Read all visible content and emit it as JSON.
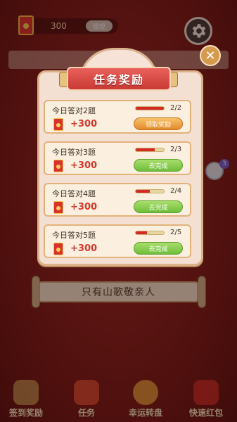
{
  "header": {
    "coin_value": "300",
    "withdraw_label": "提现"
  },
  "background": {
    "lyric_text": "只有山歌敬亲人"
  },
  "modal": {
    "title": "任务奖励",
    "tasks": [
      {
        "title": "今日答对2题",
        "reward": "+300",
        "progress_text": "2/2",
        "progress": 1.0,
        "button_label": "领取奖励",
        "button_state": "claim"
      },
      {
        "title": "今日答对3题",
        "reward": "+300",
        "progress_text": "2/3",
        "progress": 0.667,
        "button_label": "去完成",
        "button_state": "go"
      },
      {
        "title": "今日答对4题",
        "reward": "+300",
        "progress_text": "2/4",
        "progress": 0.5,
        "button_label": "去完成",
        "button_state": "go"
      },
      {
        "title": "今日答对5题",
        "reward": "+300",
        "progress_text": "2/5",
        "progress": 0.4,
        "button_label": "去完成",
        "button_state": "go"
      }
    ]
  },
  "side": {
    "badge_count": "3"
  },
  "bottom_nav": [
    {
      "label": "签到奖励",
      "icon": "calendar-icon"
    },
    {
      "label": "任务",
      "icon": "task-icon"
    },
    {
      "label": "幸运转盘",
      "icon": "wheel-icon"
    },
    {
      "label": "快速红包",
      "icon": "red-packet-icon"
    }
  ],
  "colors": {
    "accent_red": "#d32a24",
    "claim_orange": "#e48a2c",
    "go_green": "#6fbe3a"
  }
}
